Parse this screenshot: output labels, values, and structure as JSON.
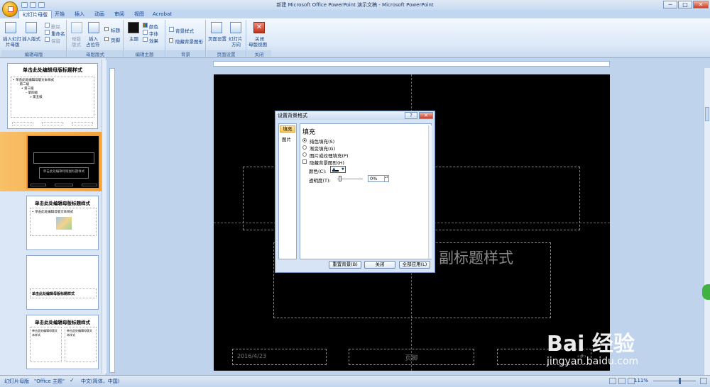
{
  "window": {
    "title": "新建 Microsoft Office PowerPoint 演示文稿 - Microsoft PowerPoint",
    "min": "─",
    "max": "□",
    "close": "✕"
  },
  "tabs": [
    "幻灯片母版",
    "开始",
    "插入",
    "动画",
    "审阅",
    "视图",
    "Acrobat"
  ],
  "ribbon": {
    "groups": {
      "edit_master": "编辑母版",
      "master_layout": "母版版式",
      "edit_theme": "编辑主题",
      "background": "背景",
      "page_setup": "页面设置",
      "close": "关闭"
    },
    "insert_master": "插入幻灯片母版",
    "insert_master_l1": "插入幻灯",
    "insert_master_l2": "片母版",
    "insert_layout_l1": "插入版式",
    "delete": "删除",
    "rename": "重命名",
    "preserve": "保留",
    "master_layout_btn_l1": "母版",
    "master_layout_btn_l2": "版式",
    "insert_placeholder_l1": "插入",
    "insert_placeholder_l2": "占位符",
    "chk_title": "标题",
    "chk_footer": "页脚",
    "theme": "主题",
    "colors": "颜色",
    "fonts": "字体",
    "effects": "效果",
    "bg_styles": "背景样式",
    "hide_bg": "隐藏背景图形",
    "page_setup_btn": "页面设置",
    "slide_orient_l1": "幻灯片",
    "slide_orient_l2": "方向",
    "close_master_l1": "关闭",
    "close_master_l2": "母版视图"
  },
  "thumbnails": {
    "t1_title": "单击此处编辑母版标题样式",
    "t1_body": "• 单击此处编辑母版文本样式",
    "t1_l2": "– 第二级",
    "t1_l3": "• 第三级",
    "t1_l4": "– 第四级",
    "t1_l5": "» 第五级",
    "t2_sub": "单击此处编辑母版副标题样式",
    "t3_title": "单击此处编辑母版标题样式",
    "t3_body": "• 单击此处编辑母版文本样式",
    "t4_title": "单击此处编辑母版标题样式",
    "t5_title": "单击此处编辑母版标题样式",
    "t5_body": "单击此处编辑母版文本样式"
  },
  "slide": {
    "subtitle_visible": "副标题样式",
    "date": "2016/4/23",
    "footer": "页脚",
    "page_num": "‹#›"
  },
  "dialog": {
    "title": "设置背景格式",
    "help": "?",
    "close": "✕",
    "nav": [
      "填充",
      "图片"
    ],
    "heading": "填充",
    "options": [
      "纯色填充(S)",
      "渐变填充(G)",
      "图片或纹理填充(P)"
    ],
    "hide_bg_check": "隐藏背景图形(H)",
    "color_label": "颜色(C):",
    "transparency_label": "透明度(T):",
    "transparency_value": "0%",
    "btn_reset": "重置背景(B)",
    "btn_close": "关闭",
    "btn_apply_all": "全部应用(L)"
  },
  "status": {
    "view": "幻灯片母版",
    "theme": "\"Office 主题\"",
    "lang": "中文(简体，中国)",
    "zoom": "111%"
  },
  "watermark": {
    "brand": "Bai 经验",
    "url": "jingyan.baidu.com"
  },
  "colors": {
    "slide_bg": "#000000",
    "selected_thumb": "#f4a23a",
    "ribbon": "#dbe8f7"
  }
}
